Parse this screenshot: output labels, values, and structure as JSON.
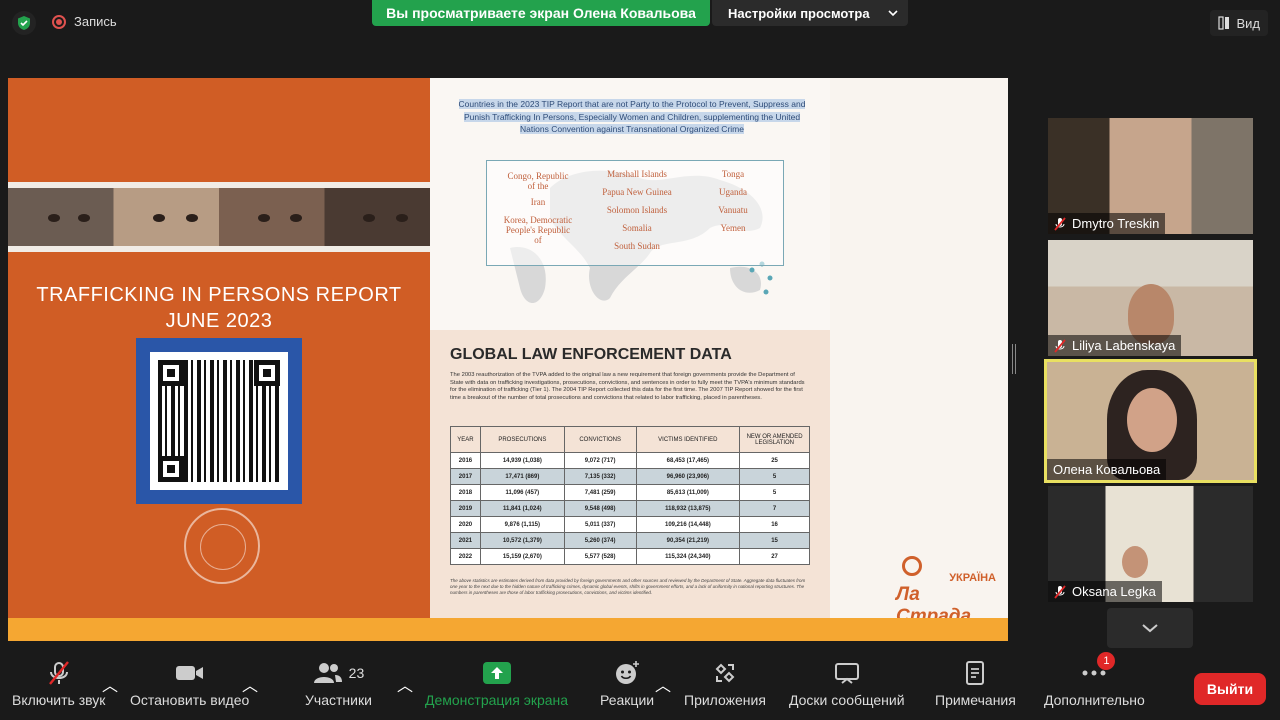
{
  "topbar": {
    "recording_label": "Запись",
    "share_banner": "Вы просматриваете экран Олена Ковальова",
    "view_options": "Настройки просмотра",
    "view_label": "Вид"
  },
  "slide": {
    "tip_title_line1": "TRAFFICKING IN PERSONS REPORT",
    "tip_title_line2": "JUNE 2023",
    "unparty_text": "Countries in the 2023 TIP Report that are not Party to the Protocol to Prevent, Suppress and Punish Trafficking In Persons, Especially Women and Children, supplementing the United Nations Convention against Transnational Organized Crime",
    "countries": {
      "col1": [
        "Congo, Republic of the",
        "Iran",
        "Korea, Democratic People's Republic of"
      ],
      "col2": [
        "Marshall Islands",
        "Papua New Guinea",
        "Solomon Islands",
        "Somalia",
        "South Sudan"
      ],
      "col3": [
        "Tonga",
        "Uganda",
        "Vanuatu",
        "Yemen"
      ]
    },
    "law_title": "GLOBAL LAW ENFORCEMENT DATA",
    "law_text": "The 2003 reauthorization of the TVPA added to the original law a new requirement that foreign governments provide the Department of State with data on trafficking investigations, prosecutions, convictions, and sentences in order to fully meet the TVPA's minimum standards for the elimination of trafficking (Tier 1). The 2004 TIP Report collected this data for the first time. The 2007 TIP Report showed for the first time a breakout of the number of total prosecutions and convictions that related to labor trafficking, placed in parentheses.",
    "table_headers": [
      "YEAR",
      "PROSECUTIONS",
      "CONVICTIONS",
      "VICTIMS IDENTIFIED",
      "NEW OR AMENDED LEGISLATION"
    ],
    "table_rows": [
      [
        "2016",
        "14,939 (1,038)",
        "9,072 (717)",
        "68,453 (17,465)",
        "25"
      ],
      [
        "2017",
        "17,471 (869)",
        "7,135 (332)",
        "96,960 (23,906)",
        "5"
      ],
      [
        "2018",
        "11,096 (457)",
        "7,481 (259)",
        "85,613 (11,009)",
        "5"
      ],
      [
        "2019",
        "11,841 (1,024)",
        "9,548 (498)",
        "118,932 (13,875)",
        "7"
      ],
      [
        "2020",
        "9,876 (1,115)",
        "5,011 (337)",
        "109,216 (14,448)",
        "16"
      ],
      [
        "2021",
        "10,572 (1,379)",
        "5,260 (374)",
        "90,354 (21,219)",
        "15"
      ],
      [
        "2022",
        "15,159 (2,670)",
        "5,577 (528)",
        "115,324 (24,340)",
        "27"
      ]
    ],
    "law_note": "The above statistics are estimates derived from data provided by foreign governments and other sources and reviewed by the Department of State. Aggregate data fluctuates from one year to the next due to the hidden nature of trafficking crimes, dynamic global events, shifts in government efforts, and a lack of uniformity in national reporting structures. The numbers in parentheses are those of labor trafficking prosecutions, convictions, and victims identified.",
    "logo_ua": "УКРАЇНА",
    "logo_name": "Ла Страда"
  },
  "participants": [
    {
      "name": "Dmytro Treskin",
      "muted": true
    },
    {
      "name": "Liliya Labenskaya",
      "muted": true
    },
    {
      "name": "Олена Ковальова",
      "muted": false,
      "active": true
    },
    {
      "name": "Oksana Legka",
      "muted": true
    }
  ],
  "toolbar": {
    "unmute": "Включить звук",
    "stop_video": "Остановить видео",
    "participants": "Участники",
    "participants_count": "23",
    "share_screen": "Демонстрация экрана",
    "reactions": "Реакции",
    "apps": "Приложения",
    "whiteboards": "Доски сообщений",
    "notes": "Примечания",
    "more": "Дополнительно",
    "more_badge": "1",
    "leave": "Выйти"
  },
  "colors": {
    "share_green": "#23a24d",
    "leave_red": "#e02828",
    "slide_orange": "#d05d25",
    "active_border": "#e9e061"
  }
}
